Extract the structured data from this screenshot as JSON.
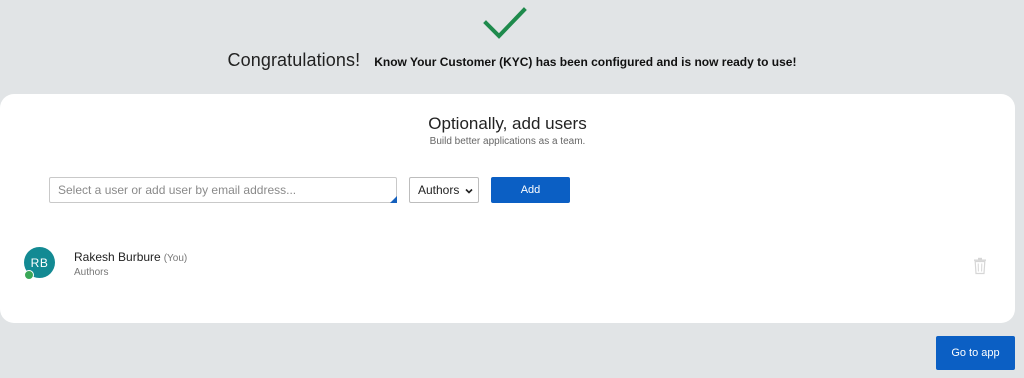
{
  "success": {
    "icon": "checkmark-icon",
    "title": "Congratulations!",
    "message": "Know Your Customer (KYC) has been configured and is now ready to use!"
  },
  "add_users": {
    "heading": "Optionally, add users",
    "subheading": "Build better applications as a team.",
    "search": {
      "placeholder": "Select a user or add user by email address...",
      "value": ""
    },
    "role_select": {
      "selected": "Authors",
      "icon": "chevron-down-icon"
    },
    "add_label": "Add"
  },
  "users": [
    {
      "initials": "RB",
      "name": "Rakesh Burbure",
      "self_tag": "(You)",
      "role": "Authors",
      "presence": "online",
      "delete_icon": "trash-icon"
    }
  ],
  "footer": {
    "go_label": "Go to app"
  },
  "colors": {
    "background": "#e1e4e6",
    "accent": "#0b5fc4",
    "check": "#1e8a4c",
    "avatar": "#138a93",
    "presence": "#3aa757"
  }
}
